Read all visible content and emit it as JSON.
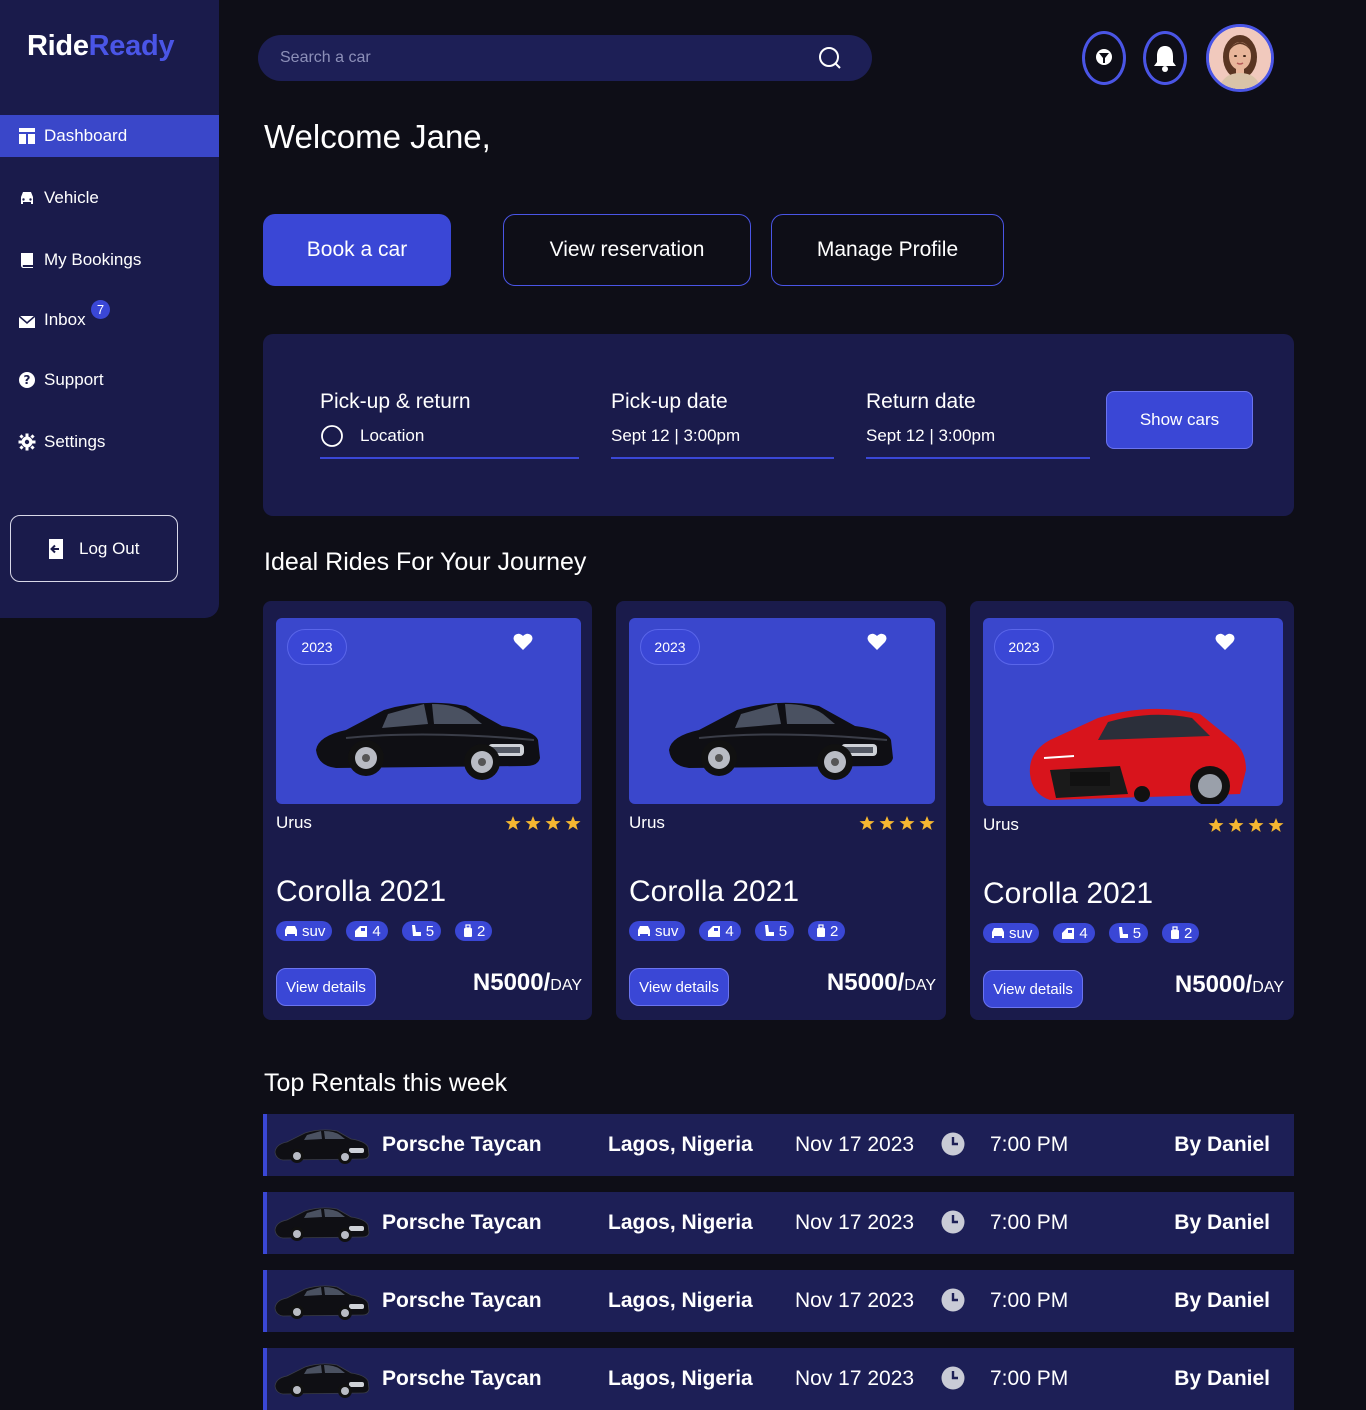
{
  "brand": {
    "part1": "Ride",
    "part2": "Ready"
  },
  "sidebar": {
    "items": [
      {
        "label": "Dashboard",
        "icon": "dashboard-icon",
        "active": true
      },
      {
        "label": "Vehicle",
        "icon": "car-icon"
      },
      {
        "label": "My Bookings",
        "icon": "book-icon"
      },
      {
        "label": "Inbox",
        "icon": "mail-icon",
        "badge": "7"
      },
      {
        "label": "Support",
        "icon": "help-icon"
      },
      {
        "label": "Settings",
        "icon": "gear-icon"
      }
    ],
    "logout_label": "Log Out"
  },
  "search": {
    "placeholder": "Search a car"
  },
  "welcome": "Welcome Jane,",
  "actions": {
    "book": "Book a car",
    "view_reservation": "View reservation",
    "manage_profile": "Manage Profile"
  },
  "booking": {
    "pickup_label": "Pick-up & return",
    "pickup_value": "Location",
    "pickup_date_label": "Pick-up date",
    "pickup_date_value": "Sept 12 | 3:00pm",
    "return_date_label": "Return date",
    "return_date_value": "Sept 12 | 3:00pm",
    "show_cars": "Show cars"
  },
  "ideal_title": "Ideal Rides For Your Journey",
  "cars": [
    {
      "year": "2023",
      "model": "Urus",
      "name": "Corolla 2021",
      "type": "suv",
      "doors": "4",
      "seats": "5",
      "bags": "2",
      "view": "View details",
      "price": "N5000/",
      "unit": "DAY",
      "rating": 4,
      "color": "black"
    },
    {
      "year": "2023",
      "model": "Urus",
      "name": "Corolla 2021",
      "type": "suv",
      "doors": "4",
      "seats": "5",
      "bags": "2",
      "view": "View details",
      "price": "N5000/",
      "unit": "DAY",
      "rating": 4,
      "color": "black"
    },
    {
      "year": "2023",
      "model": "Urus",
      "name": "Corolla 2021",
      "type": "suv",
      "doors": "4",
      "seats": "5",
      "bags": "2",
      "view": "View details",
      "price": "N5000/",
      "unit": "DAY",
      "rating": 4,
      "color": "red"
    }
  ],
  "top_title": "Top Rentals this week",
  "rentals": [
    {
      "name": "Porsche Taycan",
      "location": "Lagos, Nigeria",
      "date": "Nov 17 2023",
      "time": "7:00 PM",
      "by": "By Daniel"
    },
    {
      "name": "Porsche Taycan",
      "location": "Lagos, Nigeria",
      "date": "Nov 17 2023",
      "time": "7:00 PM",
      "by": "By Daniel"
    },
    {
      "name": "Porsche Taycan",
      "location": "Lagos, Nigeria",
      "date": "Nov 17 2023",
      "time": "7:00 PM",
      "by": "By Daniel"
    },
    {
      "name": "Porsche Taycan",
      "location": "Lagos, Nigeria",
      "date": "Nov 17 2023",
      "time": "7:00 PM",
      "by": "By Daniel"
    }
  ],
  "colors": {
    "accent": "#3a47d6",
    "panel": "#1a1b4b",
    "background": "#0e0e17",
    "star": "#f5b731"
  }
}
